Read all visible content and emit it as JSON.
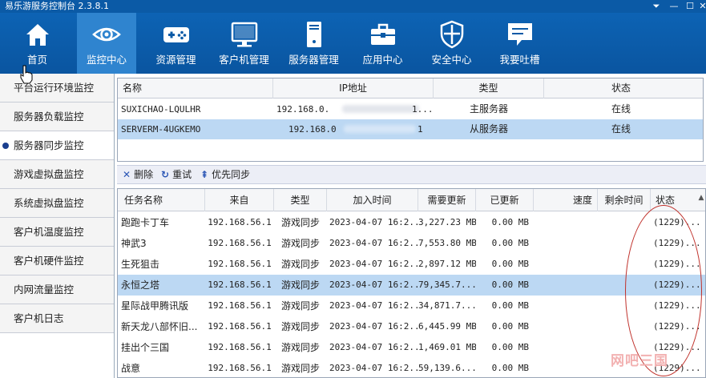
{
  "window": {
    "title": "易乐游服务控制台 2.3.8.1",
    "controls": [
      "⏷",
      "—",
      "☐",
      "✕"
    ]
  },
  "nav": [
    {
      "label": "首页",
      "icon": "home-icon",
      "active": false
    },
    {
      "label": "监控中心",
      "icon": "eye-icon",
      "active": true
    },
    {
      "label": "资源管理",
      "icon": "gamepad-icon",
      "active": false
    },
    {
      "label": "客户机管理",
      "icon": "monitor-icon",
      "active": false
    },
    {
      "label": "服务器管理",
      "icon": "server-icon",
      "active": false
    },
    {
      "label": "应用中心",
      "icon": "toolbox-icon",
      "active": false
    },
    {
      "label": "安全中心",
      "icon": "shield-icon",
      "active": false
    },
    {
      "label": "我要吐槽",
      "icon": "chat-icon",
      "active": false
    }
  ],
  "sidebar": {
    "items": [
      {
        "label": "平台运行环境监控",
        "active": false
      },
      {
        "label": "服务器负载监控",
        "active": false
      },
      {
        "label": "服务器同步监控",
        "active": true
      },
      {
        "label": "游戏虚拟盘监控",
        "active": false
      },
      {
        "label": "系统虚拟盘监控",
        "active": false
      },
      {
        "label": "客户机温度监控",
        "active": false
      },
      {
        "label": "客户机硬件监控",
        "active": false
      },
      {
        "label": "内网流量监控",
        "active": false
      },
      {
        "label": "客户机日志",
        "active": false
      }
    ]
  },
  "servers": {
    "headers": [
      "名称",
      "IP地址",
      "类型",
      "状态"
    ],
    "rows": [
      {
        "name": "SUXICHAO-LQULHR",
        "ip_start": "192.168.0.",
        "ip_end": "1...",
        "type": "主服务器",
        "status": "在线",
        "selected": false
      },
      {
        "name": "SERVERM-4UGKEMO",
        "ip_start": "192.168.0",
        "ip_end": "1",
        "type": "从服务器",
        "status": "在线",
        "selected": true
      }
    ]
  },
  "toolbar": {
    "delete_icon": "✕",
    "delete_label": "删除",
    "retry_icon": "↻",
    "retry_label": "重试",
    "priority_icon": "⇞",
    "priority_label": "优先同步"
  },
  "tasks": {
    "headers": [
      "任务名称",
      "来自",
      "类型",
      "加入时间",
      "需要更新",
      "已更新",
      "速度",
      "剩余时间",
      "状态"
    ],
    "rows": [
      {
        "name": "跑跑卡丁车",
        "from": "192.168.56.1",
        "type": "游戏同步",
        "time": "2023-04-07 16:2...",
        "need": "3,227.23 MB",
        "done": "0.00 MB",
        "speed": "",
        "remain": "",
        "status": "(1229)...",
        "selected": false
      },
      {
        "name": "神武3",
        "from": "192.168.56.1",
        "type": "游戏同步",
        "time": "2023-04-07 16:2...",
        "need": "7,553.80 MB",
        "done": "0.00 MB",
        "speed": "",
        "remain": "",
        "status": "(1229)...",
        "selected": false
      },
      {
        "name": "生死狙击",
        "from": "192.168.56.1",
        "type": "游戏同步",
        "time": "2023-04-07 16:2...",
        "need": "2,897.12 MB",
        "done": "0.00 MB",
        "speed": "",
        "remain": "",
        "status": "(1229)...",
        "selected": false
      },
      {
        "name": "永恒之塔",
        "from": "192.168.56.1",
        "type": "游戏同步",
        "time": "2023-04-07 16:2...",
        "need": "79,345.7...",
        "done": "0.00 MB",
        "speed": "",
        "remain": "",
        "status": "(1229)...",
        "selected": true
      },
      {
        "name": "星际战甲腾讯版",
        "from": "192.168.56.1",
        "type": "游戏同步",
        "time": "2023-04-07 16:2...",
        "need": "34,871.7...",
        "done": "0.00 MB",
        "speed": "",
        "remain": "",
        "status": "(1229)...",
        "selected": false
      },
      {
        "name": "新天龙八部怀旧...",
        "from": "192.168.56.1",
        "type": "游戏同步",
        "time": "2023-04-07 16:2...",
        "need": "6,445.99 MB",
        "done": "0.00 MB",
        "speed": "",
        "remain": "",
        "status": "(1229)...",
        "selected": false
      },
      {
        "name": "挂出个三国",
        "from": "192.168.56.1",
        "type": "游戏同步",
        "time": "2023-04-07 16:2...",
        "need": "1,469.01 MB",
        "done": "0.00 MB",
        "speed": "",
        "remain": "",
        "status": "(1229)...",
        "selected": false
      },
      {
        "name": "战意",
        "from": "192.168.56.1",
        "type": "游戏同步",
        "time": "2023-04-07 16:2...",
        "need": "59,139.6...",
        "done": "0.00 MB",
        "speed": "",
        "remain": "",
        "status": "(1229)...",
        "selected": false
      }
    ]
  },
  "watermark": "网吧三国",
  "colors": {
    "header_bg": "#0b5aa6",
    "nav_active": "#2f84cf",
    "row_selected": "#bcd8f3",
    "annotation_oval": "#c0312b"
  }
}
